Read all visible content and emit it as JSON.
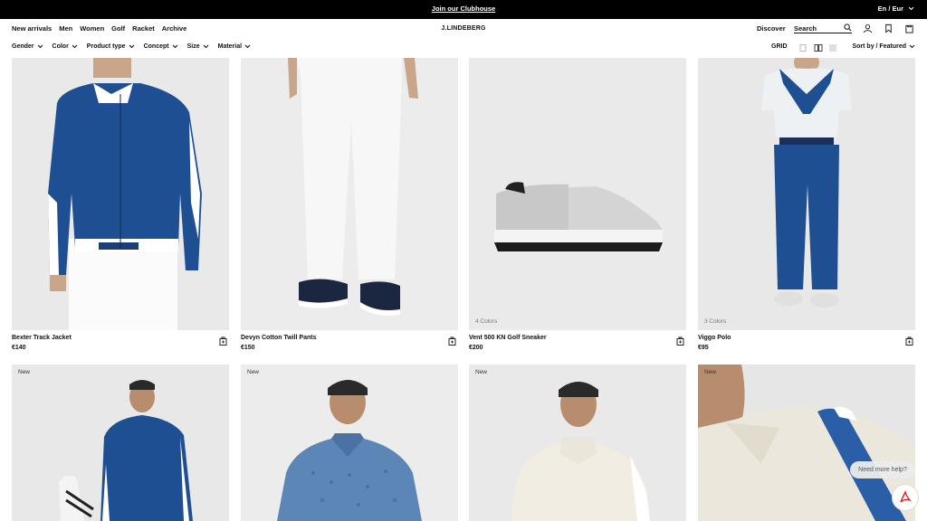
{
  "promo": {
    "text": "Join our Clubhouse",
    "language": "En / Eur"
  },
  "header": {
    "nav": [
      "New arrivals",
      "Men",
      "Women",
      "Golf",
      "Racket",
      "Archive"
    ],
    "logo": "J.LINDEBERG",
    "discover": "Discover",
    "search_placeholder": "Search"
  },
  "filters": {
    "items": [
      "Gender",
      "Color",
      "Product type",
      "Concept",
      "Size",
      "Material"
    ],
    "grid_label": "GRID",
    "sort_label": "Sort by / Featured"
  },
  "products": [
    {
      "name": "Bexter Track Jacket",
      "price": "€140",
      "colors": "",
      "badge": ""
    },
    {
      "name": "Devyn Cotton Twill Pants",
      "price": "€150",
      "colors": "",
      "badge": ""
    },
    {
      "name": "Vent 500 KN Golf Sneaker",
      "price": "€200",
      "colors": "4 Colors",
      "badge": ""
    },
    {
      "name": "Viggo Polo",
      "price": "€95",
      "colors": "3 Colors",
      "badge": ""
    },
    {
      "badge": "New"
    },
    {
      "badge": "New"
    },
    {
      "badge": "New"
    },
    {
      "badge": "New"
    }
  ],
  "help": {
    "label": "Need more help?"
  },
  "colors": {
    "primary": "#111111",
    "promo_bg": "#000000",
    "image_bg": "#ececec",
    "accent_blue": "#1f4f93"
  }
}
